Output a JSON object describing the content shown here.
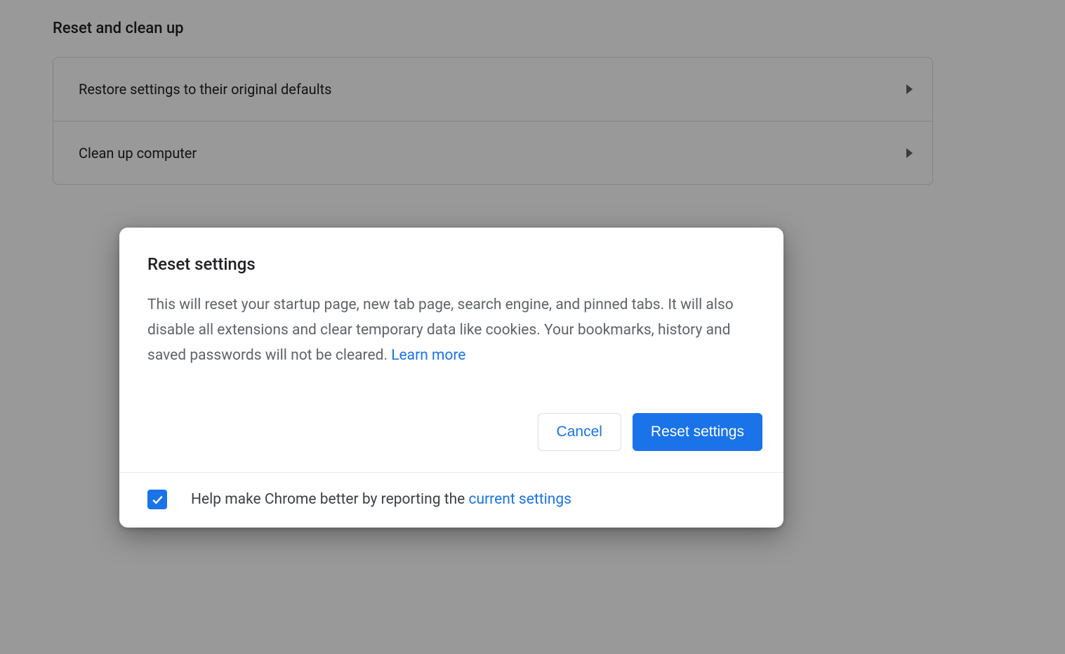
{
  "section": {
    "title": "Reset and clean up",
    "rows": [
      {
        "label": "Restore settings to their original defaults"
      },
      {
        "label": "Clean up computer"
      }
    ]
  },
  "dialog": {
    "title": "Reset settings",
    "description": "This will reset your startup page, new tab page, search engine, and pinned tabs. It will also disable all extensions and clear temporary data like cookies. Your bookmarks, history and saved passwords will not be cleared. ",
    "learn_more": "Learn more",
    "cancel": "Cancel",
    "confirm": "Reset settings",
    "footer_prefix": "Help make Chrome better by reporting the ",
    "footer_link": "current settings",
    "checkbox_checked": true
  }
}
